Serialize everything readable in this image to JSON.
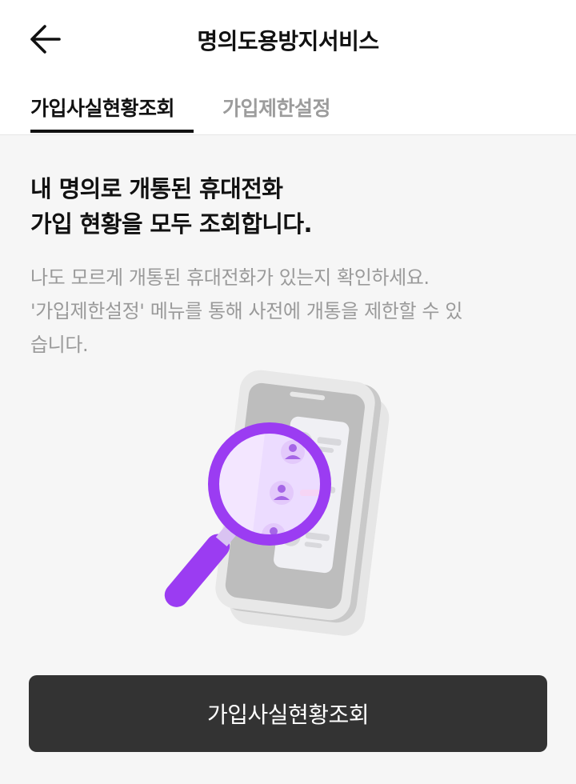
{
  "header": {
    "back_icon": "arrow-left-icon",
    "title": "명의도용방지서비스"
  },
  "tabs": [
    {
      "label": "가입사실현황조회",
      "active": true
    },
    {
      "label": "가입제한설정",
      "active": false
    }
  ],
  "main": {
    "headline_line1": "내 명의로 개통된 휴대전화",
    "headline_line2": "가입 현황을 모두 조회합니다.",
    "description_line1": "나도 모르게 개통된 휴대전화가 있는지 확인하세요.",
    "description_line2": "'가입제한설정' 메뉴를 통해 사전에 개통을 제한할 수 있",
    "description_line3": "습니다.",
    "illustration_icon": "phone-magnifier-illustration"
  },
  "cta": {
    "label": "가입사실현황조회"
  },
  "colors": {
    "accent": "#9b3cf2",
    "button_bg": "#333333",
    "background": "#f6f6f6"
  }
}
